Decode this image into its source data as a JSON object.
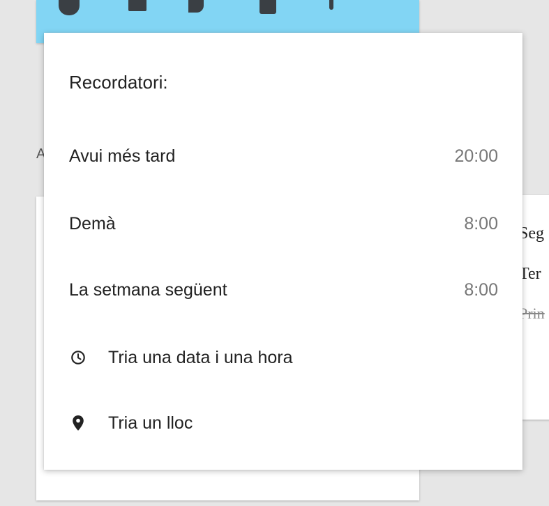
{
  "background_note": {
    "partial_letter": "A"
  },
  "right_note": {
    "lines": [
      "Seg",
      "Ter",
      "Prin"
    ]
  },
  "reminder_menu": {
    "title": "Recordatori:",
    "items": [
      {
        "label": "Avui més tard",
        "time": "20:00"
      },
      {
        "label": "Demà",
        "time": "8:00"
      },
      {
        "label": "La setmana següent",
        "time": "8:00"
      },
      {
        "label": "Tria una data i una hora",
        "icon": "clock-icon"
      },
      {
        "label": "Tria un lloc",
        "icon": "location-pin-icon"
      }
    ]
  },
  "colors": {
    "note_blue": "#82d5f4",
    "menu_background": "#ffffff",
    "page_background": "#e6e6e6"
  }
}
